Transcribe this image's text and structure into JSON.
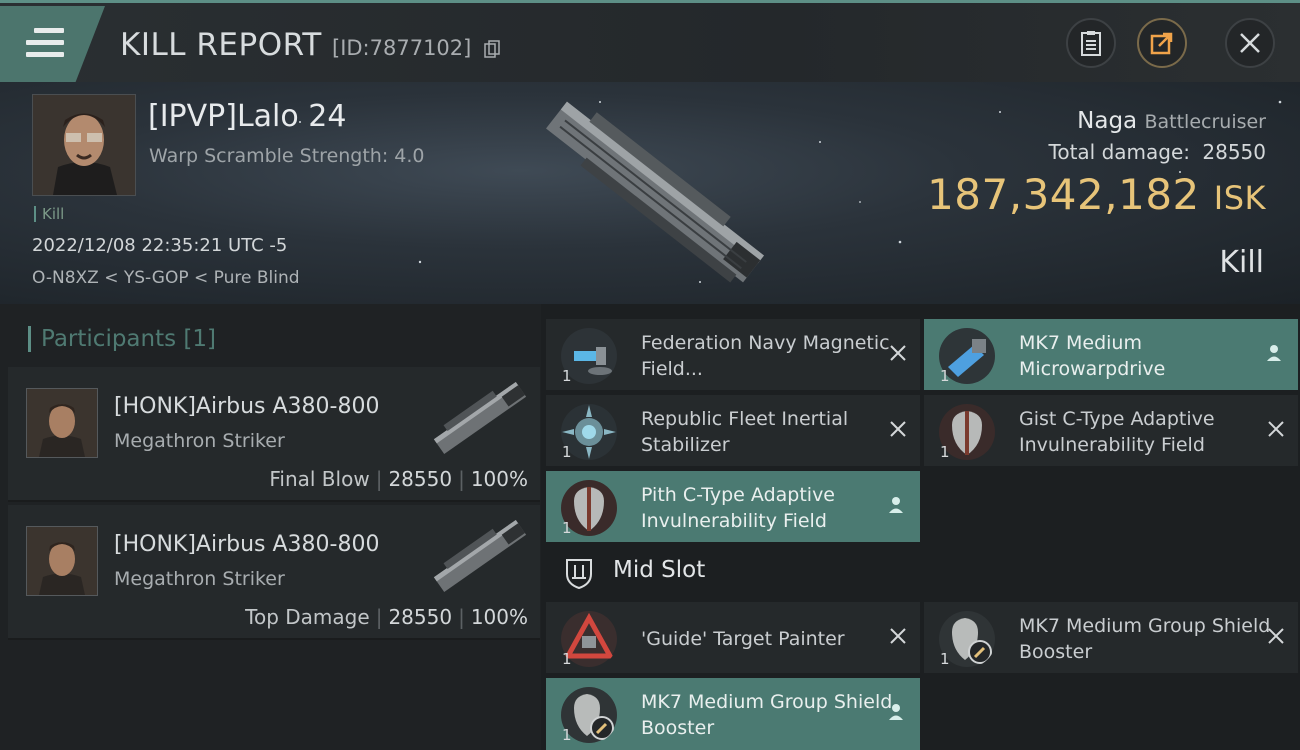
{
  "titlebar": {
    "title": "KILL REPORT",
    "kill_id": "[ID:7877102]",
    "icons": [
      "menu-icon",
      "copy-icon",
      "clipboard-icon",
      "share-icon",
      "close-icon"
    ]
  },
  "victim": {
    "pilot": "[IPVP]Lalo 24",
    "warp_scramble": "Warp Scramble Strength: 4.0",
    "kill_tag": "Kill",
    "datetime": "2022/12/08 22:35:21 UTC -5",
    "location": "O-N8XZ < YS-GOP < Pure Blind",
    "ship_name": "Naga",
    "ship_class": "Battlecruiser",
    "total_damage_label": "Total damage:",
    "total_damage": "28550",
    "isk_value": "187,342,182",
    "isk_unit": "ISK",
    "result": "Kill"
  },
  "participants": {
    "title": "Participants [1]",
    "items": [
      {
        "name": "[HONK]Airbus A380-800",
        "ship": "Megathron Striker",
        "label": "Final Blow",
        "damage": "28550",
        "percent": "100%"
      },
      {
        "name": "[HONK]Airbus A380-800",
        "ship": "Megathron Striker",
        "label": "Top Damage",
        "damage": "28550",
        "percent": "100%"
      }
    ]
  },
  "modules": {
    "top": [
      {
        "qty": "1",
        "name": "Federation Navy Magnetic Field...",
        "state": "destroyed"
      },
      {
        "qty": "1",
        "name": "MK7 Medium Microwarpdrive",
        "state": "dropped"
      },
      {
        "qty": "1",
        "name": "Republic Fleet Inertial Stabilizer",
        "state": "destroyed"
      },
      {
        "qty": "1",
        "name": "Gist C-Type Adaptive Invulnerability Field",
        "state": "destroyed"
      },
      {
        "qty": "1",
        "name": "Pith C-Type Adaptive Invulnerability Field",
        "state": "dropped"
      }
    ],
    "mid_slot_title": "Mid Slot",
    "mid": [
      {
        "qty": "1",
        "name": "'Guide' Target Painter",
        "state": "destroyed"
      },
      {
        "qty": "1",
        "name": "MK7 Medium Group Shield Booster",
        "state": "destroyed"
      },
      {
        "qty": "1",
        "name": "MK7 Medium Group Shield Booster",
        "state": "dropped"
      }
    ]
  },
  "colors": {
    "accent": "#4b7a72",
    "isk": "#e7c479",
    "panel": "#25292b"
  }
}
